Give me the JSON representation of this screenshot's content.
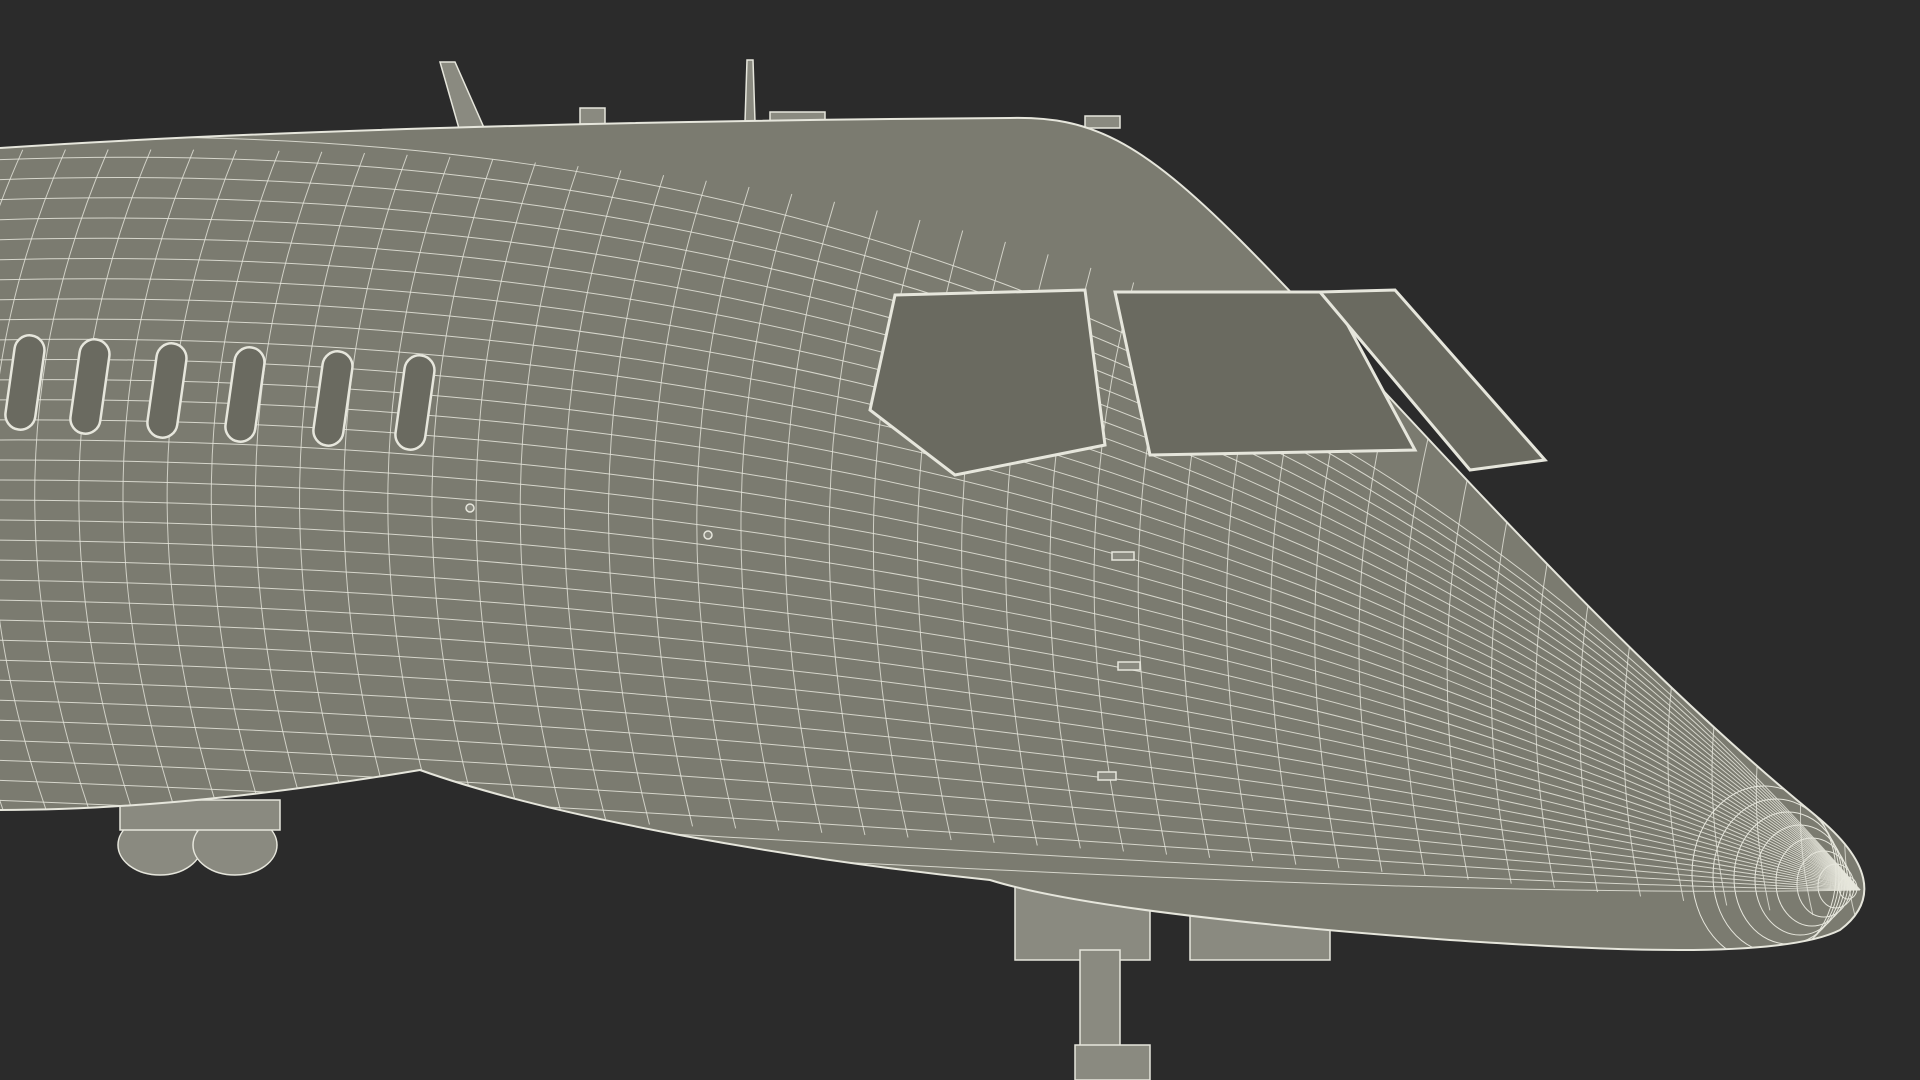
{
  "scene": {
    "subject": "aircraft-nose-wireframe",
    "colors": {
      "background": "#2b2b2b",
      "surface": "#7b7b70",
      "surface_shadow": "#6a6a60",
      "wire": "#e6e6dc",
      "gear": "#8a8a80"
    }
  }
}
